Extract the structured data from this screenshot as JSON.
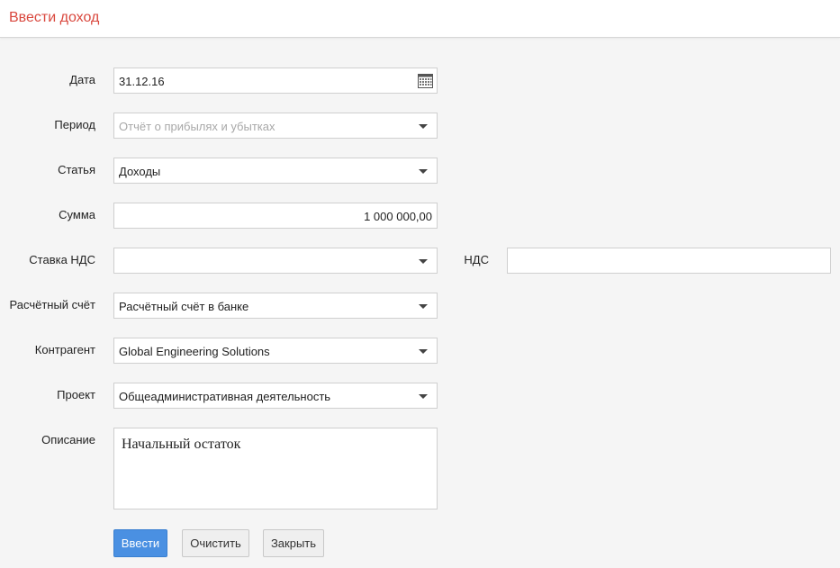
{
  "header": {
    "title": "Ввести доход"
  },
  "form": {
    "date": {
      "label": "Дата",
      "value": "31.12.16"
    },
    "period": {
      "label": "Период",
      "placeholder": "Отчёт о прибылях и убытках"
    },
    "article": {
      "label": "Статья",
      "value": "Доходы"
    },
    "amount": {
      "label": "Сумма",
      "value": "1 000 000,00"
    },
    "vat_rate": {
      "label": "Ставка НДС",
      "value": ""
    },
    "vat": {
      "label": "НДС",
      "value": ""
    },
    "account": {
      "label": "Расчётный счёт",
      "value": "Расчётный счёт в банке"
    },
    "counterparty": {
      "label": "Контрагент",
      "value": "Global Engineering Solutions"
    },
    "project": {
      "label": "Проект",
      "value": "Общеадминистративная деятельность"
    },
    "description": {
      "label": "Описание",
      "value": "Начальный остаток"
    }
  },
  "buttons": {
    "submit": "Ввести",
    "clear": "Очистить",
    "close": "Закрыть"
  },
  "colors": {
    "title": "#d9473d",
    "primary_button": "#4a90e2",
    "background": "#f5f5f5"
  },
  "icons": {
    "date_picker": "calendar-icon",
    "dropdown": "chevron-down-icon"
  }
}
